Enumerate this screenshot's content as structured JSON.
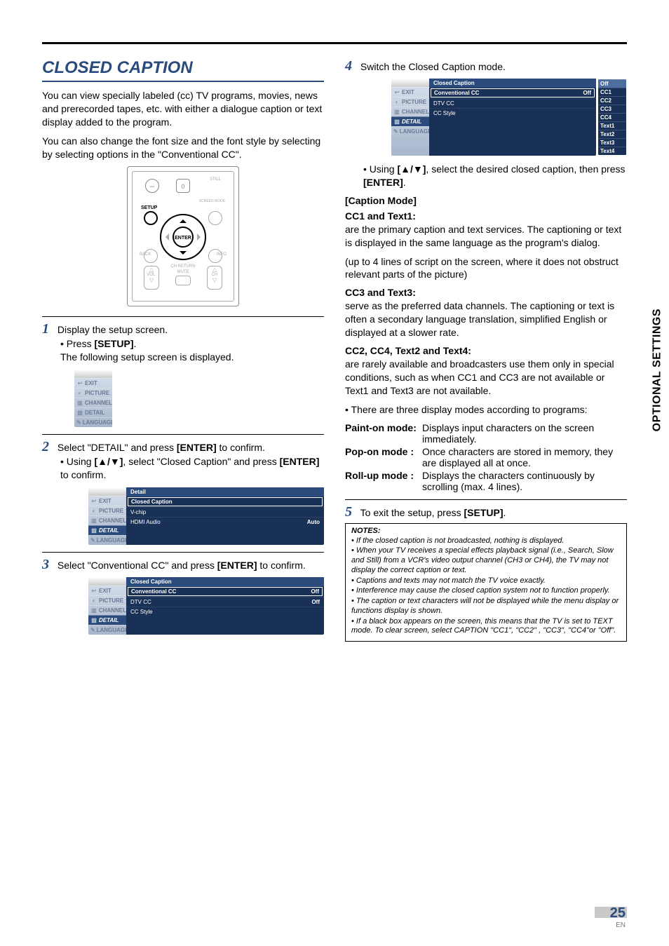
{
  "section_tab": "OPTIONAL SETTINGS",
  "page_number": "25",
  "page_lang": "EN",
  "title": "CLOSED CAPTION",
  "intro1": "You can view specially labeled (cc) TV programs, movies, news and prerecorded tapes, etc. with either a dialogue caption or text display added to the program.",
  "intro2": "You can also change the font size and the font style by selecting by selecting options in the \"Conventional CC\".",
  "remote": {
    "zero": "0",
    "dash": "–",
    "still": "STILL",
    "setup": "SETUP",
    "screen_mode": "SCREEN MODE",
    "enter": "ENTER",
    "back": "BACK",
    "info": "INFO",
    "chret": "CH RETURN",
    "vol": "VOL.",
    "ch": "CH",
    "mute": "MUTE"
  },
  "side_labels": {
    "exit": "EXIT",
    "picture": "PICTURE",
    "channel": "CHANNEL",
    "detail": "DETAIL",
    "language": "LANGUAGE"
  },
  "step1": {
    "text": "Display the setup screen.",
    "bullet_prefix": "Press ",
    "bullet_key": "[SETUP]",
    "bullet_suffix": ".",
    "line2": "The following setup screen is displayed."
  },
  "step2": {
    "prefix": "Select \"DETAIL\" and press ",
    "key": "[ENTER]",
    "suffix": " to confirm.",
    "b_prefix": "Using ",
    "b_key": "[▲/▼]",
    "b_mid": ", select \"Closed Caption\" and press ",
    "b_key2": "[ENTER]",
    "b_suffix": " to confirm.",
    "menu_title": "Detail",
    "menu_items": [
      {
        "label": "Closed Caption",
        "value": "",
        "hl": true
      },
      {
        "label": "V-chip",
        "value": ""
      },
      {
        "label": "HDMI Audio",
        "value": "Auto"
      }
    ]
  },
  "step3": {
    "prefix": "Select \"Conventional CC\" and press  ",
    "key": "[ENTER]",
    "suffix": " to confirm.",
    "menu_title": "Closed Caption",
    "menu_items": [
      {
        "label": "Conventional CC",
        "value": "Off",
        "hl": true
      },
      {
        "label": "DTV CC",
        "value": "Off"
      },
      {
        "label": "CC Style",
        "value": ""
      }
    ]
  },
  "step4": {
    "text": "Switch the Closed Caption mode.",
    "menu_title": "Closed Caption",
    "menu_items": [
      {
        "label": "Conventional CC",
        "value": "Off",
        "hl": true
      },
      {
        "label": "DTV CC",
        "value": ""
      },
      {
        "label": "CC Style",
        "value": ""
      }
    ],
    "dropdown": [
      "Off",
      "CC1",
      "CC2",
      "CC3",
      "CC4",
      "Text1",
      "Text2",
      "Text3",
      "Text4"
    ],
    "b_prefix": "Using ",
    "b_key": "[▲/▼]",
    "b_mid": ", select the desired closed caption, then press ",
    "b_key2": "[ENTER]",
    "b_suffix": "."
  },
  "caption_mode_h": "[Caption Mode]",
  "cc1_h": "CC1 and Text1:",
  "cc1_p1": "are the primary caption and text services. The captioning or text is displayed in the same language as the program's dialog.",
  "cc1_p2": "(up to 4 lines of script on the screen, where it does not obstruct relevant parts of the picture)",
  "cc3_h": "CC3 and Text3:",
  "cc3_p": "serve as the preferred data channels. The captioning or text is often a secondary language translation, simplified English or displayed at a slower rate.",
  "cc2_h": "CC2, CC4, Text2 and Text4:",
  "cc2_p": "are rarely available and broadcasters use them only in special conditions, such as when CC1 and CC3 are not available or Text1 and Text3 are not available.",
  "modes_intro": "There are three display modes according to programs:",
  "modes": [
    {
      "label": "Paint-on mode:",
      "desc": "Displays input characters on the screen immediately."
    },
    {
      "label": "Pop-on mode  :",
      "desc": "Once characters are stored in memory, they are displayed all at once."
    },
    {
      "label": "Roll-up mode :",
      "desc": "Displays the characters continuously by scrolling (max. 4 lines)."
    }
  ],
  "step5": {
    "prefix": "To exit the setup, press ",
    "key": "[SETUP]",
    "suffix": "."
  },
  "notes_h": "NOTES:",
  "notes": [
    "If the closed caption is not broadcasted, nothing is displayed.",
    "When your TV receives a special effects playback signal (i.e., Search, Slow and Still) from a VCR's video output channel (CH3 or CH4), the TV may not display the correct caption or text.",
    "Captions and texts may not match the TV voice exactly.",
    "Interference may cause the closed caption system not to function properly.",
    "The caption or text characters will not be displayed while the menu display or functions display is shown.",
    "If a black box appears on the screen, this means that the TV is set to TEXT mode. To clear screen, select CAPTION \"CC1\", \"CC2\" , \"CC3\", \"CC4\"or \"Off\"."
  ]
}
